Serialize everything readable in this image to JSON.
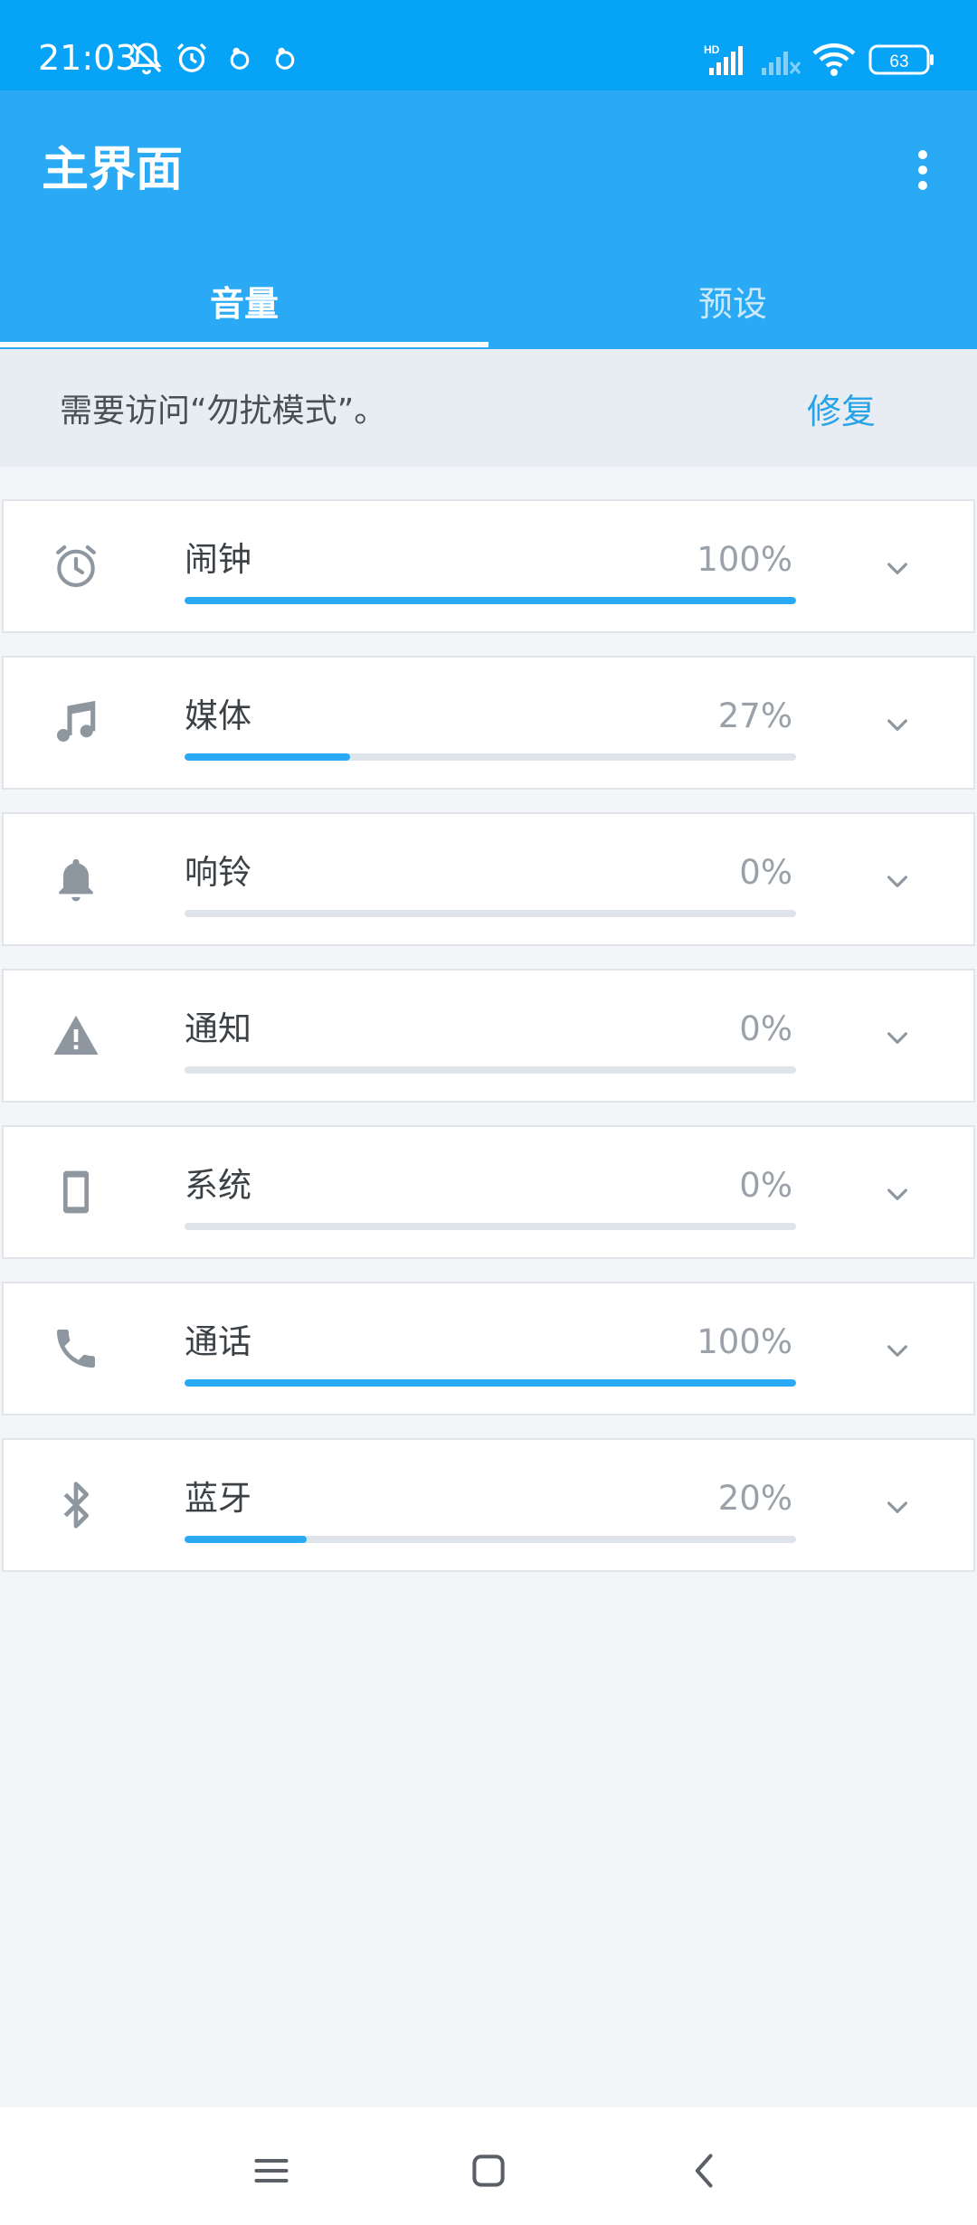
{
  "status_bar": {
    "time": "21:03",
    "battery": "63",
    "network": "HD",
    "icons": [
      "mute-notification-icon",
      "alarm-icon",
      "app-icon",
      "app-icon",
      "signal-icon",
      "signal-no-service-icon",
      "wifi-icon",
      "battery-icon"
    ]
  },
  "app": {
    "title": "主界面",
    "menu_icon": "more-vert-icon"
  },
  "tabs": [
    {
      "label": "音量",
      "selected": true
    },
    {
      "label": "预设",
      "selected": false
    }
  ],
  "notice": {
    "text": "需要访问“勿扰模式”。",
    "action": "修复"
  },
  "volumes": [
    {
      "label": "闹钟",
      "value": "100%",
      "level": 100,
      "icon": "alarm-clock-icon"
    },
    {
      "label": "媒体",
      "value": "27%",
      "level": 27,
      "icon": "music-note-icon"
    },
    {
      "label": "响铃",
      "value": "0%",
      "level": 0,
      "icon": "bell-icon"
    },
    {
      "label": "通知",
      "value": "0%",
      "level": 0,
      "icon": "warning-icon"
    },
    {
      "label": "系统",
      "value": "0%",
      "level": 0,
      "icon": "phone-device-icon"
    },
    {
      "label": "通话",
      "value": "100%",
      "level": 100,
      "icon": "phone-call-icon"
    },
    {
      "label": "蓝牙",
      "value": "20%",
      "level": 20,
      "icon": "bluetooth-icon"
    }
  ],
  "colors": {
    "accent": "#2aaaf5",
    "status_bar": "#06a3f6",
    "track": "#dfe4ea",
    "icon_gray": "#8e979f"
  },
  "nav_bar": [
    "menu-icon",
    "home-icon",
    "back-icon"
  ]
}
